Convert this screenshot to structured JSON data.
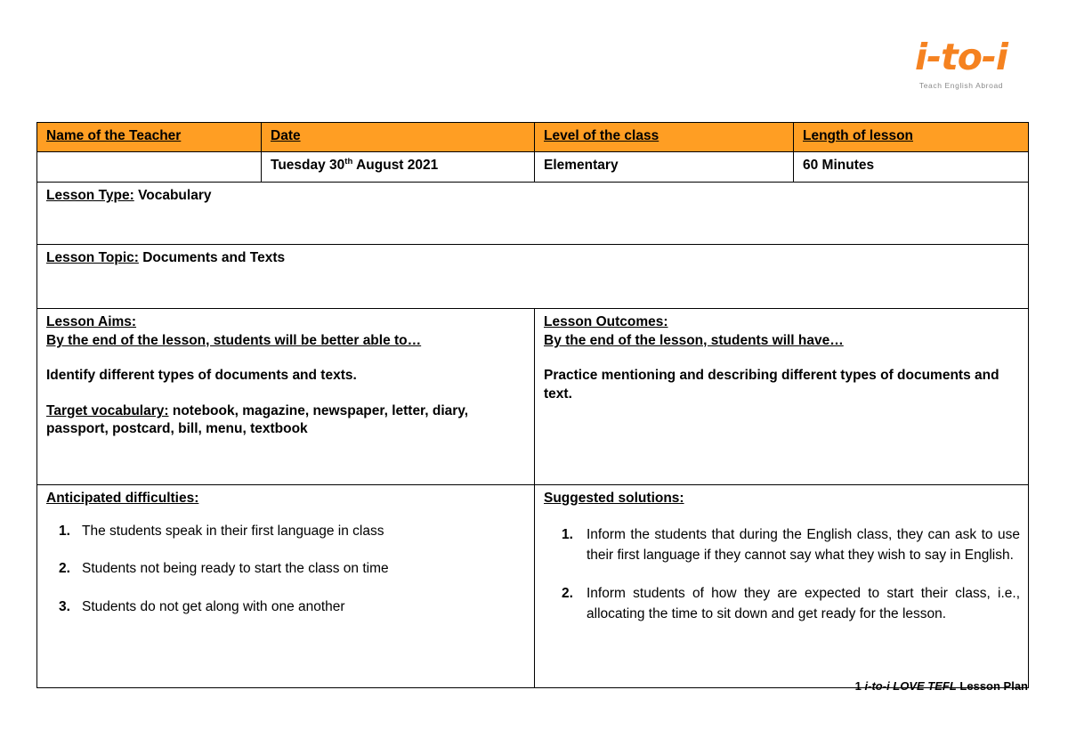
{
  "logo": {
    "mark": "i-to-i",
    "tagline": "Teach English Abroad",
    "color": "#F58220"
  },
  "theme": {
    "header_fill": "#FF9E23",
    "border": "#000000",
    "text": "#000000"
  },
  "table": {
    "headers": {
      "teacher_name": "Name of the Teacher",
      "date": "Date",
      "level": "Level of the class",
      "length": "Length of lesson"
    },
    "values": {
      "teacher_name": "",
      "date_day": "Tuesday 30",
      "date_ordinal": "th",
      "date_rest": " August 2021",
      "level": "Elementary",
      "length": "60 Minutes"
    },
    "lesson_type": {
      "label": "Lesson Type:",
      "value": " Vocabulary"
    },
    "lesson_topic": {
      "label": "Lesson Topic:",
      "value": " Documents and Texts"
    },
    "lesson_aims": {
      "label": "Lesson Aims:",
      "stem": "By the end of the lesson, students will be better able to…",
      "body": "Identify different types of documents and texts.",
      "vocab_label": "Target vocabulary:",
      "vocab_value": " notebook, magazine, newspaper, letter, diary, passport, postcard, bill, menu, textbook"
    },
    "lesson_outcomes": {
      "label": "Lesson Outcomes:",
      "stem": "By the end of the lesson, students will have…",
      "body": "Practice mentioning and describing different types of documents and text."
    },
    "anticipated_difficulties": {
      "label": "Anticipated difficulties:",
      "items": [
        "The students speak in their first language in class",
        "Students not being ready to start the class on time",
        "Students do not get along with one another"
      ]
    },
    "suggested_solutions": {
      "label": "Suggested solutions:",
      "items": [
        "Inform the students that during the English class, they can ask to use their first language if they cannot say what they wish to say in English.",
        "Inform students of how they are expected to start their class, i.e., allocating the time to sit down and get ready for the lesson."
      ]
    }
  },
  "footer": {
    "page_number": "1",
    "brand": "i-to-i LOVE TEFL",
    "doc_type": "Lesson Plan"
  }
}
